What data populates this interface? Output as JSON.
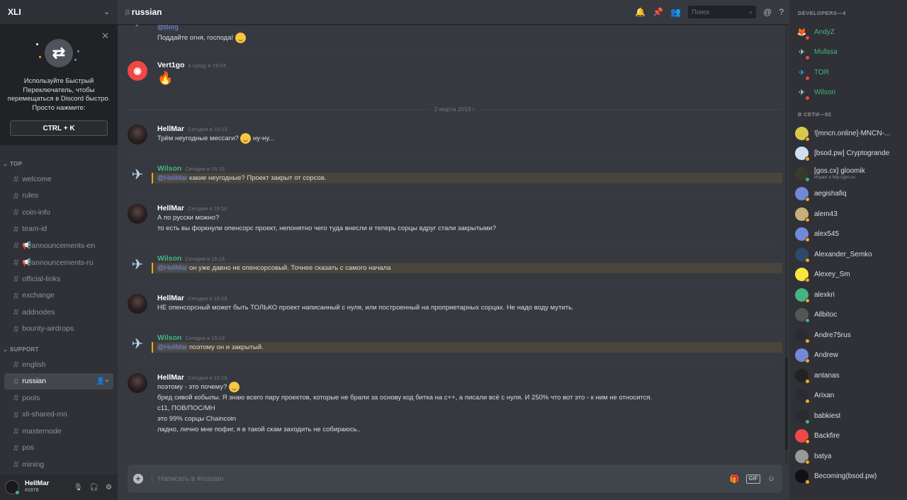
{
  "guild": {
    "name": "XLI"
  },
  "quick_switcher": {
    "text": "Используйте Быстрый Переключатель, чтобы перемещаться в Discord быстро. Просто нажмите:",
    "shortcut": "CTRL + K"
  },
  "categories": [
    {
      "name": "TOP",
      "channels": [
        "welcome",
        "rules",
        "coin-info",
        "team-id",
        "📢announcements-en",
        "📢announcements-ru",
        "official-links",
        "exchange",
        "addnodes",
        "bounty-airdrops"
      ]
    },
    {
      "name": "SUPPORT",
      "channels": [
        "english",
        "russian",
        "pools",
        "xli-shared-mn",
        "masternode",
        "pos",
        "mining"
      ]
    }
  ],
  "active_channel": "russian",
  "user": {
    "name": "HellMar",
    "discriminator": "#1878"
  },
  "topbar": {
    "channel": "russian",
    "search_placeholder": "Поиск"
  },
  "messages": [
    {
      "author": "",
      "time": "",
      "lines": [
        "@Borg",
        "Поддайте огня, господа!"
      ]
    },
    {
      "author": "Vert1go",
      "time": "в среду в 19:24",
      "lines": [
        "🔥"
      ]
    },
    {
      "author": "HellMar",
      "time": "Сегодня в 15:13",
      "lines": [
        "Трём неугодные мессаги?",
        "ну-ну..."
      ]
    },
    {
      "author": "Wilson",
      "time": "Сегодня в 15:16",
      "mention": "@HellMar",
      "lines": [
        "какие неугодные? Проект закрыт от сорсов."
      ]
    },
    {
      "author": "HellMar",
      "time": "Сегодня в 15:16",
      "lines": [
        "А по русски можно?",
        "то есть вы форкнули опенсорс проект, непонятно чего туда внесли и теперь сорцы вдруг стали закрытыми?"
      ]
    },
    {
      "author": "Wilson",
      "time": "Сегодня в 15:18",
      "mention": "@HellMar",
      "lines": [
        "он уже давно не опенсорсовый. Точнее сказать с самого начала"
      ]
    },
    {
      "author": "HellMar",
      "time": "Сегодня в 15:18",
      "lines": [
        "НЕ опенсорсный может быть ТОЛЬКО проект написанный с нуля, или построенный на проприетарных сорцах. Не надо воду мутить."
      ]
    },
    {
      "author": "Wilson",
      "time": "Сегодня в 15:19",
      "mention": "@HellMar",
      "lines": [
        "поэтому он и закрытый."
      ]
    },
    {
      "author": "HellMar",
      "time": "Сегодня в 15:19",
      "lines": [
        "поэтому - это почему?",
        "бред сивой кобылы. Я знаю всего пару проектов, которые не брали за основу код битка на с++, а писали всё с нуля. И 250% что вот это - к ним не относится.",
        "c11, ПОВ/ПОС/МН",
        "это 99% сорцы Chaincoin",
        "ладно, лично мне пофиг, я в такой скам заходить не собираюсь.."
      ]
    }
  ],
  "date_divider": "2 марта 2019 г.",
  "input": {
    "placeholder": "Написать в #russian"
  },
  "members": {
    "developers_header": "DEVELOPERS—4",
    "developers": [
      "AndyZ",
      "Mufasa",
      "TOR",
      "Wilson"
    ],
    "online_header": "В СЕТИ—92",
    "online": [
      {
        "name": "![mncn.online]-MNCN-..."
      },
      {
        "name": "[bsod.pw] Cryptogrande"
      },
      {
        "name": "[gos.cx] gloomik",
        "sub": "Играет в http://gos.cx"
      },
      {
        "name": "aegishafiq"
      },
      {
        "name": "alem43"
      },
      {
        "name": "alex545"
      },
      {
        "name": "Alexander_Semko"
      },
      {
        "name": "Alexey_Sm"
      },
      {
        "name": "alexkri"
      },
      {
        "name": "Allbitoc"
      },
      {
        "name": "Andre75rus"
      },
      {
        "name": "Andrew"
      },
      {
        "name": "antanas"
      },
      {
        "name": "Arixan"
      },
      {
        "name": "babkiest"
      },
      {
        "name": "Backfire"
      },
      {
        "name": "batya"
      },
      {
        "name": "Becoming(bsod.pw)"
      }
    ]
  },
  "colors": {
    "accent": "#7289da",
    "green": "#43b581",
    "mention_bar": "#faa61a",
    "dnd": "#f04747",
    "idle": "#faa61a"
  }
}
